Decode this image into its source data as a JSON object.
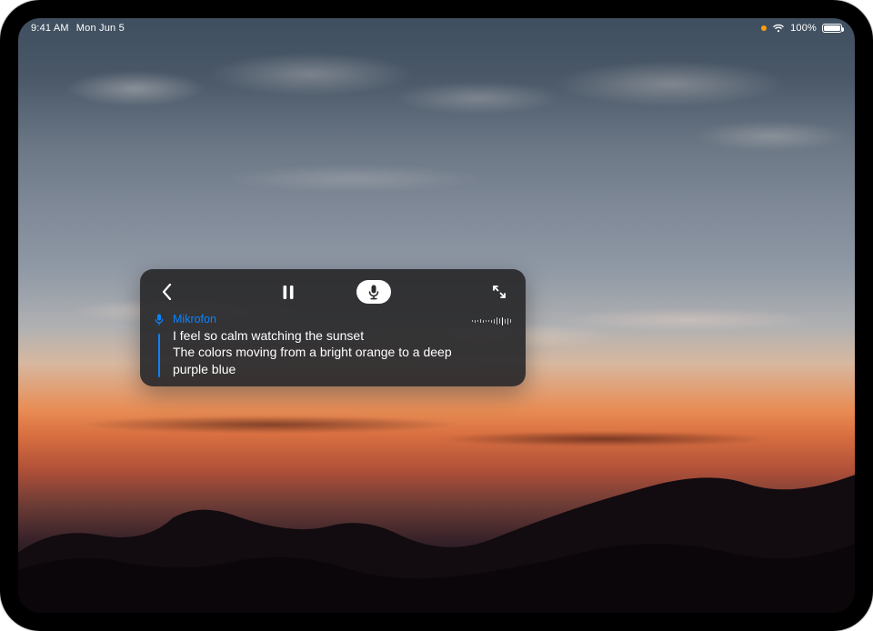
{
  "status": {
    "time": "9:41 AM",
    "date": "Mon Jun 5",
    "battery_pct": "100%"
  },
  "panel": {
    "source_label": "Mikrofon",
    "line1": "I feel so calm watching the sunset",
    "line2": "The colors moving from a bright orange to a deep",
    "line3": "purple blue"
  },
  "icons": {
    "back": "back-icon",
    "pause": "pause-icon",
    "mic": "microphone-icon",
    "expand": "expand-icon",
    "mic_indicator": "mic-active-dot",
    "wifi": "wifi-icon",
    "battery": "battery-icon"
  }
}
